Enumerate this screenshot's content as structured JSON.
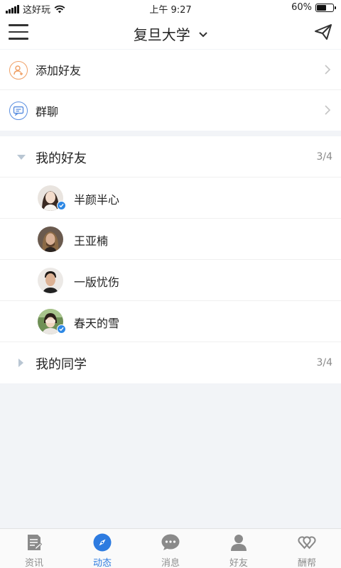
{
  "status_bar": {
    "carrier": "这好玩",
    "time": "上午 9:27",
    "battery": "60%",
    "battery_level": 0.6
  },
  "navbar": {
    "title": "复旦大学",
    "menu_icon": "hamburger-icon",
    "send_icon": "paper-plane-icon"
  },
  "actions": [
    {
      "label": "添加好友",
      "icon": "add-friend-icon",
      "color": "#f0a066"
    },
    {
      "label": "群聊",
      "icon": "group-chat-icon",
      "color": "#5b8fe0"
    }
  ],
  "groups": [
    {
      "title": "我的好友",
      "count": "3/4",
      "expanded": true,
      "friends": [
        {
          "name": "半颜半心",
          "verified": true
        },
        {
          "name": "王亚楠",
          "verified": false
        },
        {
          "name": "一版忧伤",
          "verified": false
        },
        {
          "name": "春天的雪",
          "verified": true
        }
      ]
    },
    {
      "title": "我的同学",
      "count": "3/4",
      "expanded": false
    }
  ],
  "tabbar": {
    "active": "动态",
    "tabs": [
      {
        "label": "资讯",
        "icon": "news-doc-icon"
      },
      {
        "label": "动态",
        "icon": "compass-icon"
      },
      {
        "label": "消息",
        "icon": "chat-bubble-icon"
      },
      {
        "label": "好友",
        "icon": "person-icon"
      },
      {
        "label": "酬帮",
        "icon": "hearts-icon"
      }
    ]
  },
  "colors": {
    "accent": "#2d7be0",
    "background": "#f2f4f7"
  }
}
